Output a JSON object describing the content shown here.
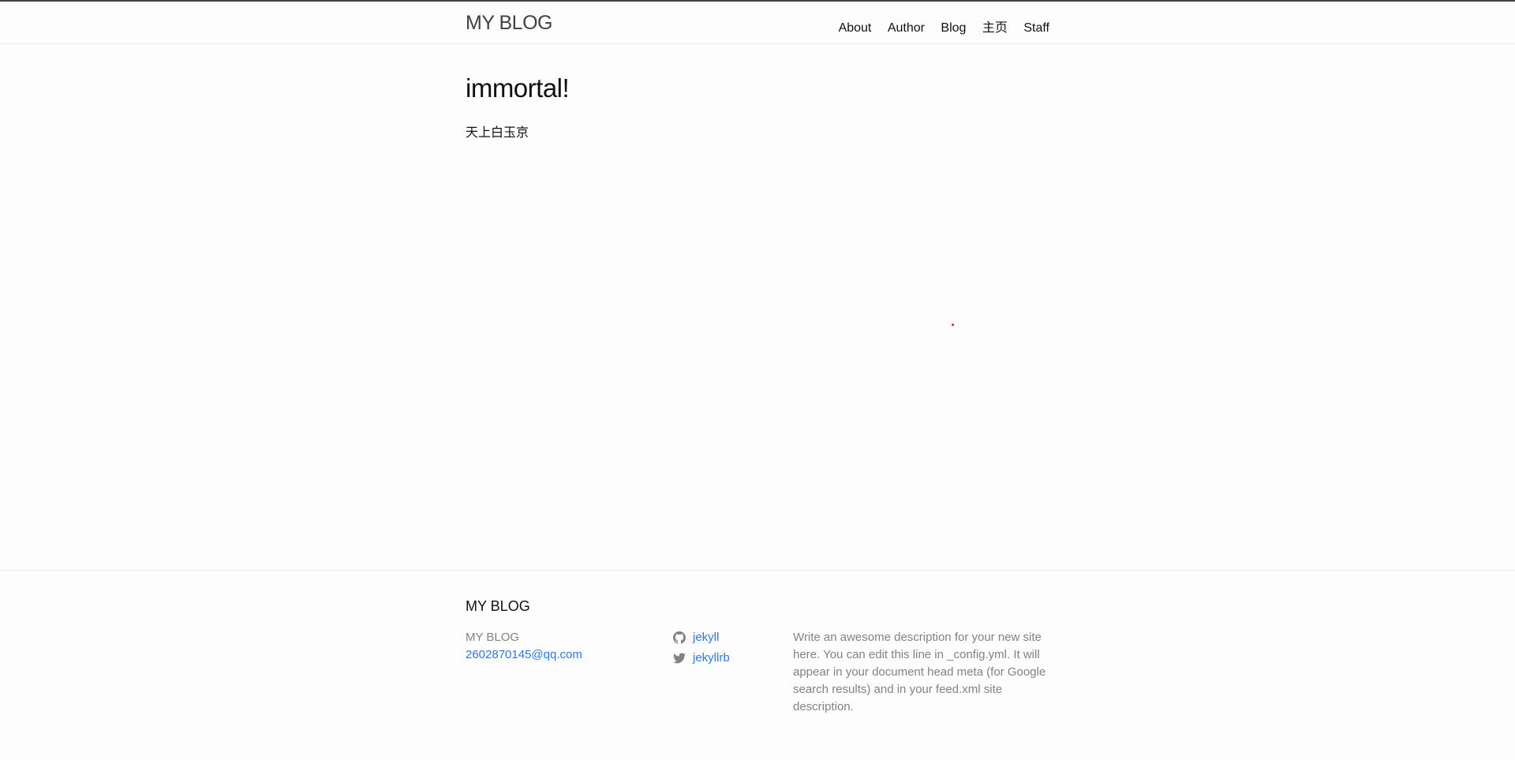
{
  "header": {
    "site_title": "MY BLOG",
    "nav": [
      "About",
      "Author",
      "Blog",
      "主页",
      "Staff"
    ]
  },
  "post": {
    "title": "immortal!",
    "body": "天上白玉京"
  },
  "footer": {
    "heading": "MY BLOG",
    "name": "MY BLOG",
    "email": "2602870145@qq.com",
    "github": {
      "icon": "github-icon",
      "username": "jekyll"
    },
    "twitter": {
      "icon": "twitter-icon",
      "username": "jekyllrb"
    },
    "description": "Write an awesome description for your new site here. You can edit this line in _config.yml. It will appear in your document head meta (for Google search results) and in your feed.xml site description."
  },
  "colors": {
    "link": "#2a7ae2",
    "muted": "#828282",
    "red_dot": "#e02020"
  }
}
